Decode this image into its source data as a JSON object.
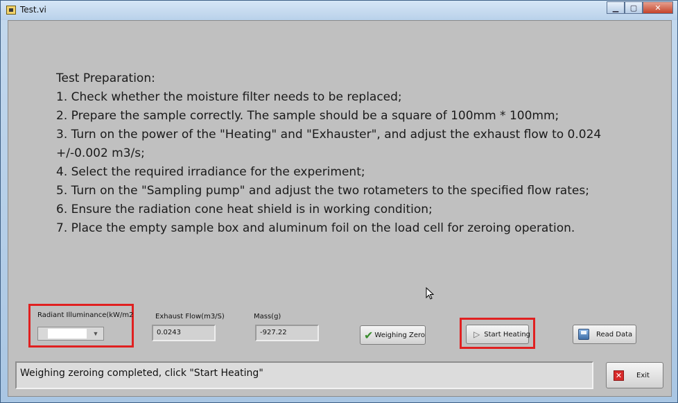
{
  "window": {
    "title": "Test.vi",
    "controls": {
      "minimize": "▁",
      "maximize": "▢",
      "close": "✕"
    }
  },
  "instructions": {
    "heading": "Test Preparation:",
    "steps": [
      "1. Check whether the moisture filter needs to be replaced;",
      "2. Prepare the sample correctly. The sample should be a square of 100mm * 100mm;",
      "3. Turn on the power of the \"Heating\" and \"Exhauster\", and adjust the exhaust flow to 0.024 +/-0.002 m3/s;",
      "4. Select the required irradiance for the experiment;",
      "5. Turn on the \"Sampling pump\" and adjust the two rotameters to the specified flow rates;",
      "6. Ensure the radiation cone heat shield is in working condition;",
      "7. Place the empty sample box and aluminum foil on the load cell for zeroing operation."
    ]
  },
  "controls": {
    "radiant_illuminance": {
      "label": "Radiant Illuminance(kW/m2",
      "value": ""
    },
    "exhaust_flow": {
      "label": "Exhaust Flow(m3/S)",
      "value": "0.0243"
    },
    "mass": {
      "label": "Mass(g)",
      "value": "-927.22"
    }
  },
  "buttons": {
    "weighing_zero": "Weighing Zero",
    "start_heating": "Start Heating",
    "read_data": "Read Data",
    "exit": "Exit"
  },
  "status": {
    "message": "Weighing zeroing completed, click \"Start Heating\""
  },
  "colors": {
    "panel_bg": "#c0c0c0",
    "highlight": "#e02020"
  }
}
